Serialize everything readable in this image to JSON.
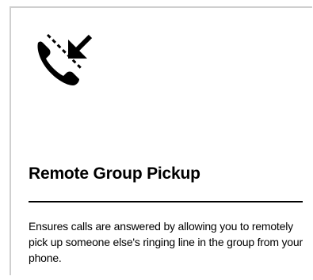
{
  "card": {
    "icon": "remote-call-pickup-icon",
    "title": "Remote Group Pickup",
    "description": "Ensures calls are answered by allowing you to remotely pick up someone else's ringing line in the group from your phone."
  },
  "colors": {
    "text": "#000000",
    "border": "#cfcfcf",
    "background": "#ffffff"
  }
}
